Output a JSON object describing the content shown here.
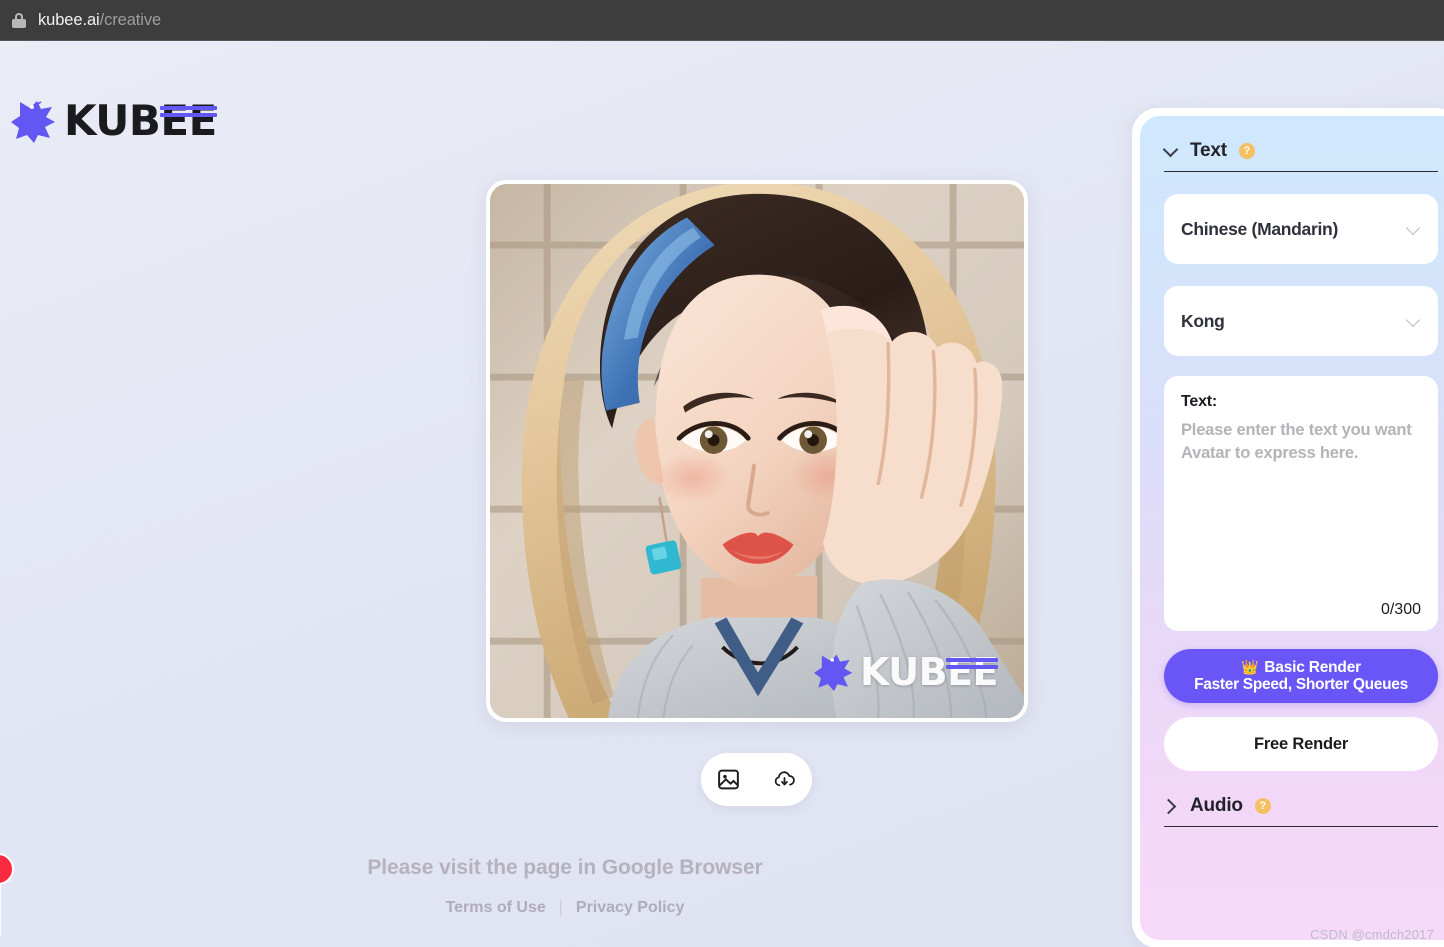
{
  "browser": {
    "lock_icon": "lock-icon",
    "url_domain": "kubee.ai",
    "url_path": "/creative"
  },
  "brand": {
    "logo_icon": "kubee-bee-logo-icon",
    "wordmark": "KUBEE",
    "accent_color": "#6257f2"
  },
  "stage": {
    "avatar_alt": "AI generated portrait of a woman with blonde hair and blue headband",
    "watermark_text": "KUBEE",
    "actions": [
      {
        "icon": "image-icon",
        "name": "preview-image-button"
      },
      {
        "icon": "cloud-download-icon",
        "name": "download-button"
      }
    ]
  },
  "footer": {
    "notice": "Please visit the page in Google Browser",
    "terms_label": "Terms of Use",
    "separator": "|",
    "privacy_label": "Privacy Policy"
  },
  "panel": {
    "text_section": {
      "chevron_icon": "chevron-down-icon",
      "title": "Text",
      "help_icon": "help-circle-icon",
      "help_label": "?",
      "language_select": {
        "value": "Chinese (Mandarin)",
        "caret_icon": "chevron-down-icon"
      },
      "voice_select": {
        "value": "Kong",
        "caret_icon": "chevron-down-icon"
      },
      "textarea": {
        "label": "Text:",
        "placeholder": "Please enter the text you want Avatar to express here.",
        "value": "",
        "counter": "0/300"
      },
      "basic_render_button": {
        "crown_icon": "crown-icon",
        "crown_glyph": "👑",
        "line1": "Basic Render",
        "line2": "Faster Speed, Shorter Queues",
        "color": "#6a56f6"
      },
      "free_render_button": {
        "label": "Free Render"
      }
    },
    "audio_section": {
      "chevron_icon": "chevron-right-icon",
      "title": "Audio",
      "help_icon": "help-circle-icon",
      "help_label": "?"
    }
  },
  "overlay": {
    "csdn_watermark": "CSDN @cmdch2017"
  }
}
